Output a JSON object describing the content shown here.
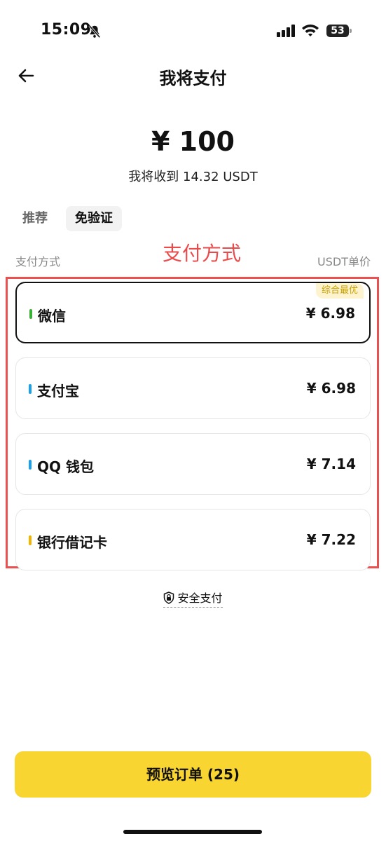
{
  "status": {
    "time": "15:09",
    "battery": "53"
  },
  "header": {
    "title": "我将支付"
  },
  "payment": {
    "amount": "¥ 100",
    "receive": "我将收到 14.32 USDT"
  },
  "tabs": [
    {
      "label": "推荐"
    },
    {
      "label": "免验证"
    }
  ],
  "columns": {
    "left": "支付方式",
    "right": "USDT单价"
  },
  "annotation": {
    "label": "支付方式",
    "color": "#ea4a4a"
  },
  "methods": [
    {
      "name": "微信",
      "price": "¥ 6.98",
      "color": "#3cb034",
      "badge": "综合最优",
      "selected": true
    },
    {
      "name": "支付宝",
      "price": "¥ 6.98",
      "color": "#1aa0ea"
    },
    {
      "name": "QQ 钱包",
      "price": "¥ 7.14",
      "color": "#1aa0ea"
    },
    {
      "name": "银行借记卡",
      "price": "¥ 7.22",
      "color": "#f2b400"
    }
  ],
  "secure": {
    "label": "安全支付"
  },
  "footer": {
    "button": "预览订单 (25)",
    "accent": "#f9d531"
  },
  "icons": {
    "back": "back-arrow-icon",
    "bell": "bell-slash-icon",
    "signal": "signal-icon",
    "wifi": "wifi-icon",
    "battery": "battery-icon",
    "lock": "shield-lock-icon"
  }
}
